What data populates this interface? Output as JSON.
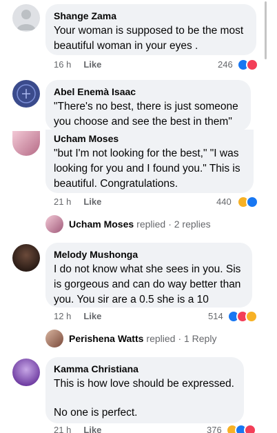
{
  "comments": [
    {
      "author": "Shange Zama",
      "text": "Your woman is supposed to be the most beautiful woman in your eyes .",
      "time": "16 h",
      "like_label": "Like",
      "reaction_count": "246",
      "reactions": [
        "like",
        "love"
      ]
    },
    {
      "author": "Abel Enemà Isaac",
      "text": "\"There's no best, there is just someone you choose and see the best in them\""
    },
    {
      "author": "Ucham Moses",
      "text": "\"but I'm not looking for the best,\" \"I was looking for you and I found you.\"  This is beautiful. Congratulations.",
      "time": "21 h",
      "like_label": "Like",
      "reaction_count": "440",
      "reactions": [
        "haha",
        "like"
      ]
    },
    {
      "author": "Melody Mushonga",
      "text": "I do not know what she sees in you. Sis is gorgeous and can do way better than you. You sir are a 0.5 she is a 10",
      "time": "12 h",
      "like_label": "Like",
      "reaction_count": "514",
      "reactions": [
        "like",
        "love",
        "haha"
      ]
    },
    {
      "author": "Kamma Christiana",
      "text_line1": "This is how love should be expressed.",
      "text_line2": "No one is perfect.",
      "time": "21 h",
      "like_label": "Like",
      "reaction_count": "376",
      "reactions": [
        "haha",
        "like",
        "love"
      ]
    }
  ],
  "replies": [
    {
      "name": "Ucham Moses",
      "action": "replied",
      "count": "· 2 replies"
    },
    {
      "name": "Perishena Watts",
      "action": "replied",
      "count": "· 1 Reply"
    }
  ],
  "colors": {
    "bubble": "#f0f2f5",
    "like": "#1877f2",
    "love": "#f33e58",
    "haha": "#f7b125"
  }
}
